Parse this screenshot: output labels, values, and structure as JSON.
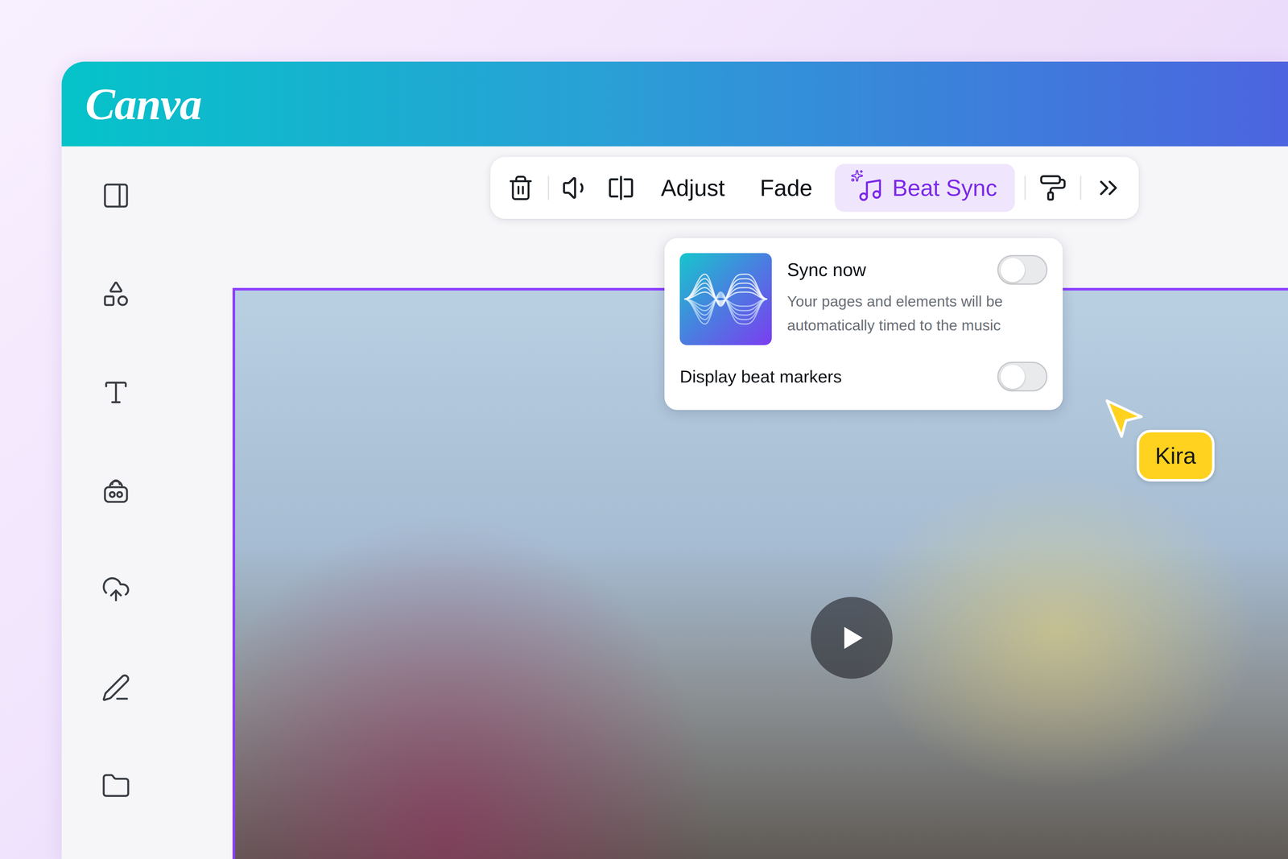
{
  "app": {
    "logo": "Canva"
  },
  "toolbar": {
    "buttons": [
      {
        "label": "Adjust",
        "kind": "text",
        "selected": false
      },
      {
        "label": "Fade",
        "kind": "text",
        "selected": false
      },
      {
        "label": "Beat Sync",
        "kind": "feature",
        "selected": true
      }
    ]
  },
  "beat_sync_panel": {
    "sync": {
      "label": "Sync now",
      "description": "Your pages and elements will be automatically timed to the music",
      "on": false
    },
    "markers": {
      "label": "Display beat markers",
      "on": false
    }
  },
  "collaborator_cursor": {
    "name": "Kira"
  }
}
